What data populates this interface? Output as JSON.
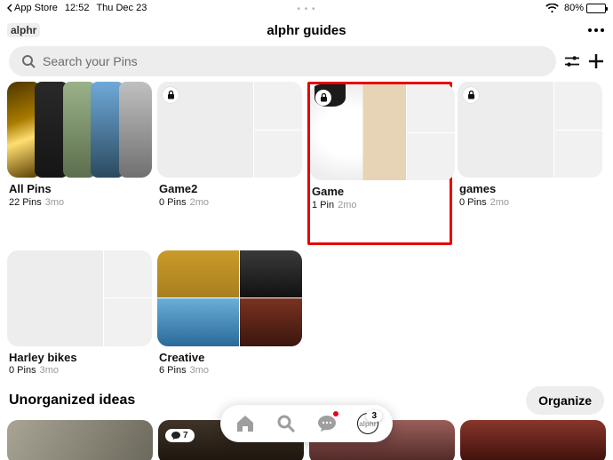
{
  "status": {
    "back_app": "App Store",
    "time": "12:52",
    "date": "Thu Dec 23",
    "battery_pct": "80%"
  },
  "header": {
    "logo": "alphr",
    "title": "alphr guides"
  },
  "search": {
    "placeholder": "Search your Pins"
  },
  "boards": [
    {
      "name": "All Pins",
      "count": "22 Pins",
      "age": "3mo",
      "locked": false,
      "cover": "allpins",
      "highlighted": false
    },
    {
      "name": "Game2",
      "count": "0 Pins",
      "age": "2mo",
      "locked": true,
      "cover": "empty",
      "highlighted": false
    },
    {
      "name": "Game",
      "count": "1 Pin",
      "age": "2mo",
      "locked": true,
      "cover": "game",
      "highlighted": true
    },
    {
      "name": "games",
      "count": "0 Pins",
      "age": "2mo",
      "locked": true,
      "cover": "empty",
      "highlighted": false
    },
    {
      "name": "Harley bikes",
      "count": "0 Pins",
      "age": "3mo",
      "locked": false,
      "cover": "empty",
      "highlighted": false
    },
    {
      "name": "Creative",
      "count": "6 Pins",
      "age": "3mo",
      "locked": false,
      "cover": "creative",
      "highlighted": false
    }
  ],
  "unorganized": {
    "title": "Unorganized ideas",
    "button": "Organize",
    "comment_badge": "7"
  },
  "nav": {
    "badge": "3"
  }
}
